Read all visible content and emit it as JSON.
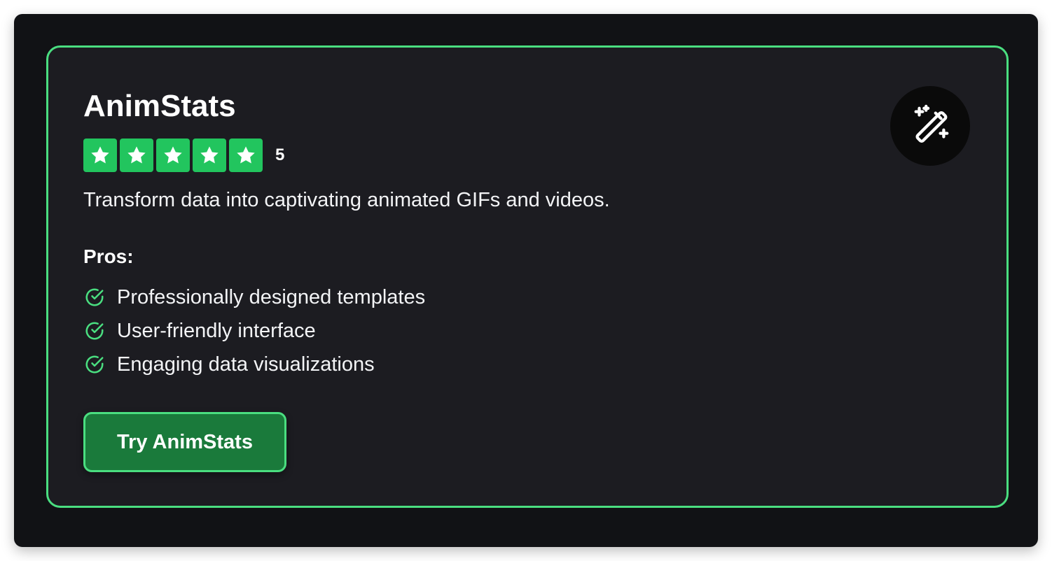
{
  "card": {
    "title": "AnimStats",
    "rating": {
      "value": "5",
      "stars_filled": 5,
      "stars_total": 5,
      "star_color": "#22c55e"
    },
    "description": "Transform data into captivating animated GIFs and videos.",
    "pros_heading": "Pros:",
    "pros": [
      "Professionally designed templates",
      "User-friendly interface",
      "Engaging data visualizations"
    ],
    "cta_label": "Try AnimStats",
    "icon": "magic-wand-icon",
    "accent_color": "#4ade80"
  }
}
